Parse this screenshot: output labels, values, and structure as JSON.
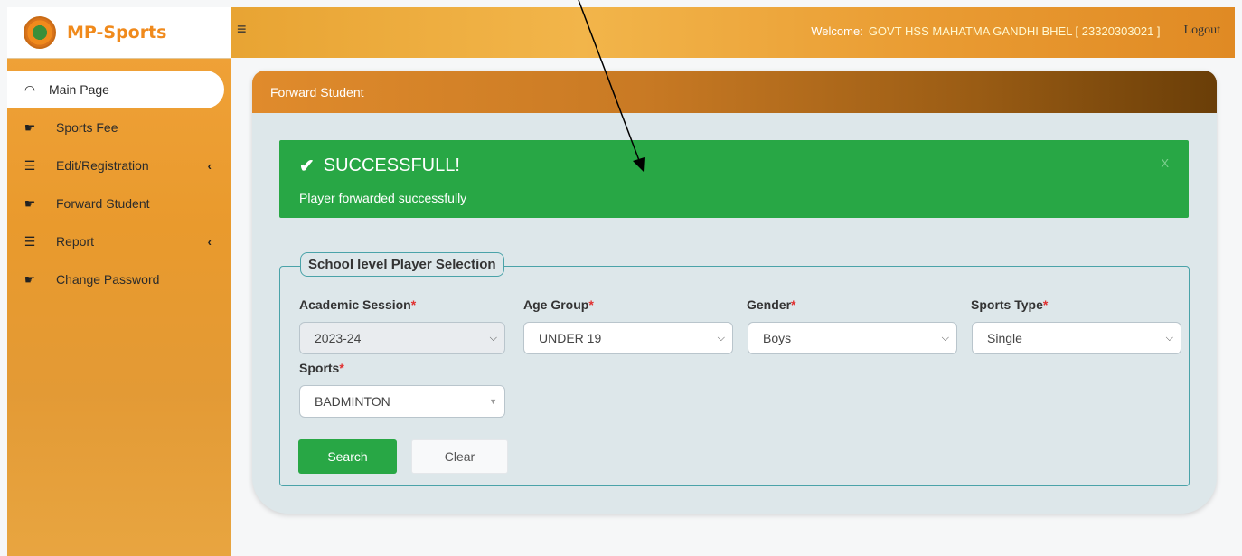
{
  "brand": {
    "name": "MP-Sports"
  },
  "sidebar": {
    "items": [
      {
        "label": "Main Page",
        "icon": "dashboard-icon",
        "active": true
      },
      {
        "label": "Sports Fee",
        "icon": "hand-pointer-icon"
      },
      {
        "label": "Edit/Registration",
        "icon": "list-icon",
        "caret": "‹"
      },
      {
        "label": "Forward Student",
        "icon": "hand-pointer-icon"
      },
      {
        "label": "Report",
        "icon": "list-icon",
        "caret": "‹"
      },
      {
        "label": "Change Password",
        "icon": "hand-pointer-icon"
      }
    ]
  },
  "topbar": {
    "menu_icon": "≡",
    "welcome_label": "Welcome:",
    "school": "GOVT HSS MAHATMA GANDHI BHEL [ 23320303021 ]",
    "logout": "Logout"
  },
  "card": {
    "title": "Forward Student"
  },
  "alert": {
    "title": "SUCCESSFULL!",
    "message": "Player forwarded successfully",
    "close": "X"
  },
  "form": {
    "legend": "School level Player Selection",
    "required_mark": "*",
    "fields": [
      {
        "label": "Academic Session",
        "value": "2023-24",
        "disabled": true
      },
      {
        "label": "Age Group",
        "value": "UNDER 19"
      },
      {
        "label": "Gender",
        "value": "Boys"
      },
      {
        "label": "Sports Type",
        "value": "Single"
      },
      {
        "label": "Sports",
        "value": "BADMINTON"
      }
    ],
    "search_label": "Search",
    "clear_label": "Clear"
  },
  "colors": {
    "accent": "#f08a1c",
    "success": "#28a745",
    "header_dark": "#6a3e08"
  }
}
